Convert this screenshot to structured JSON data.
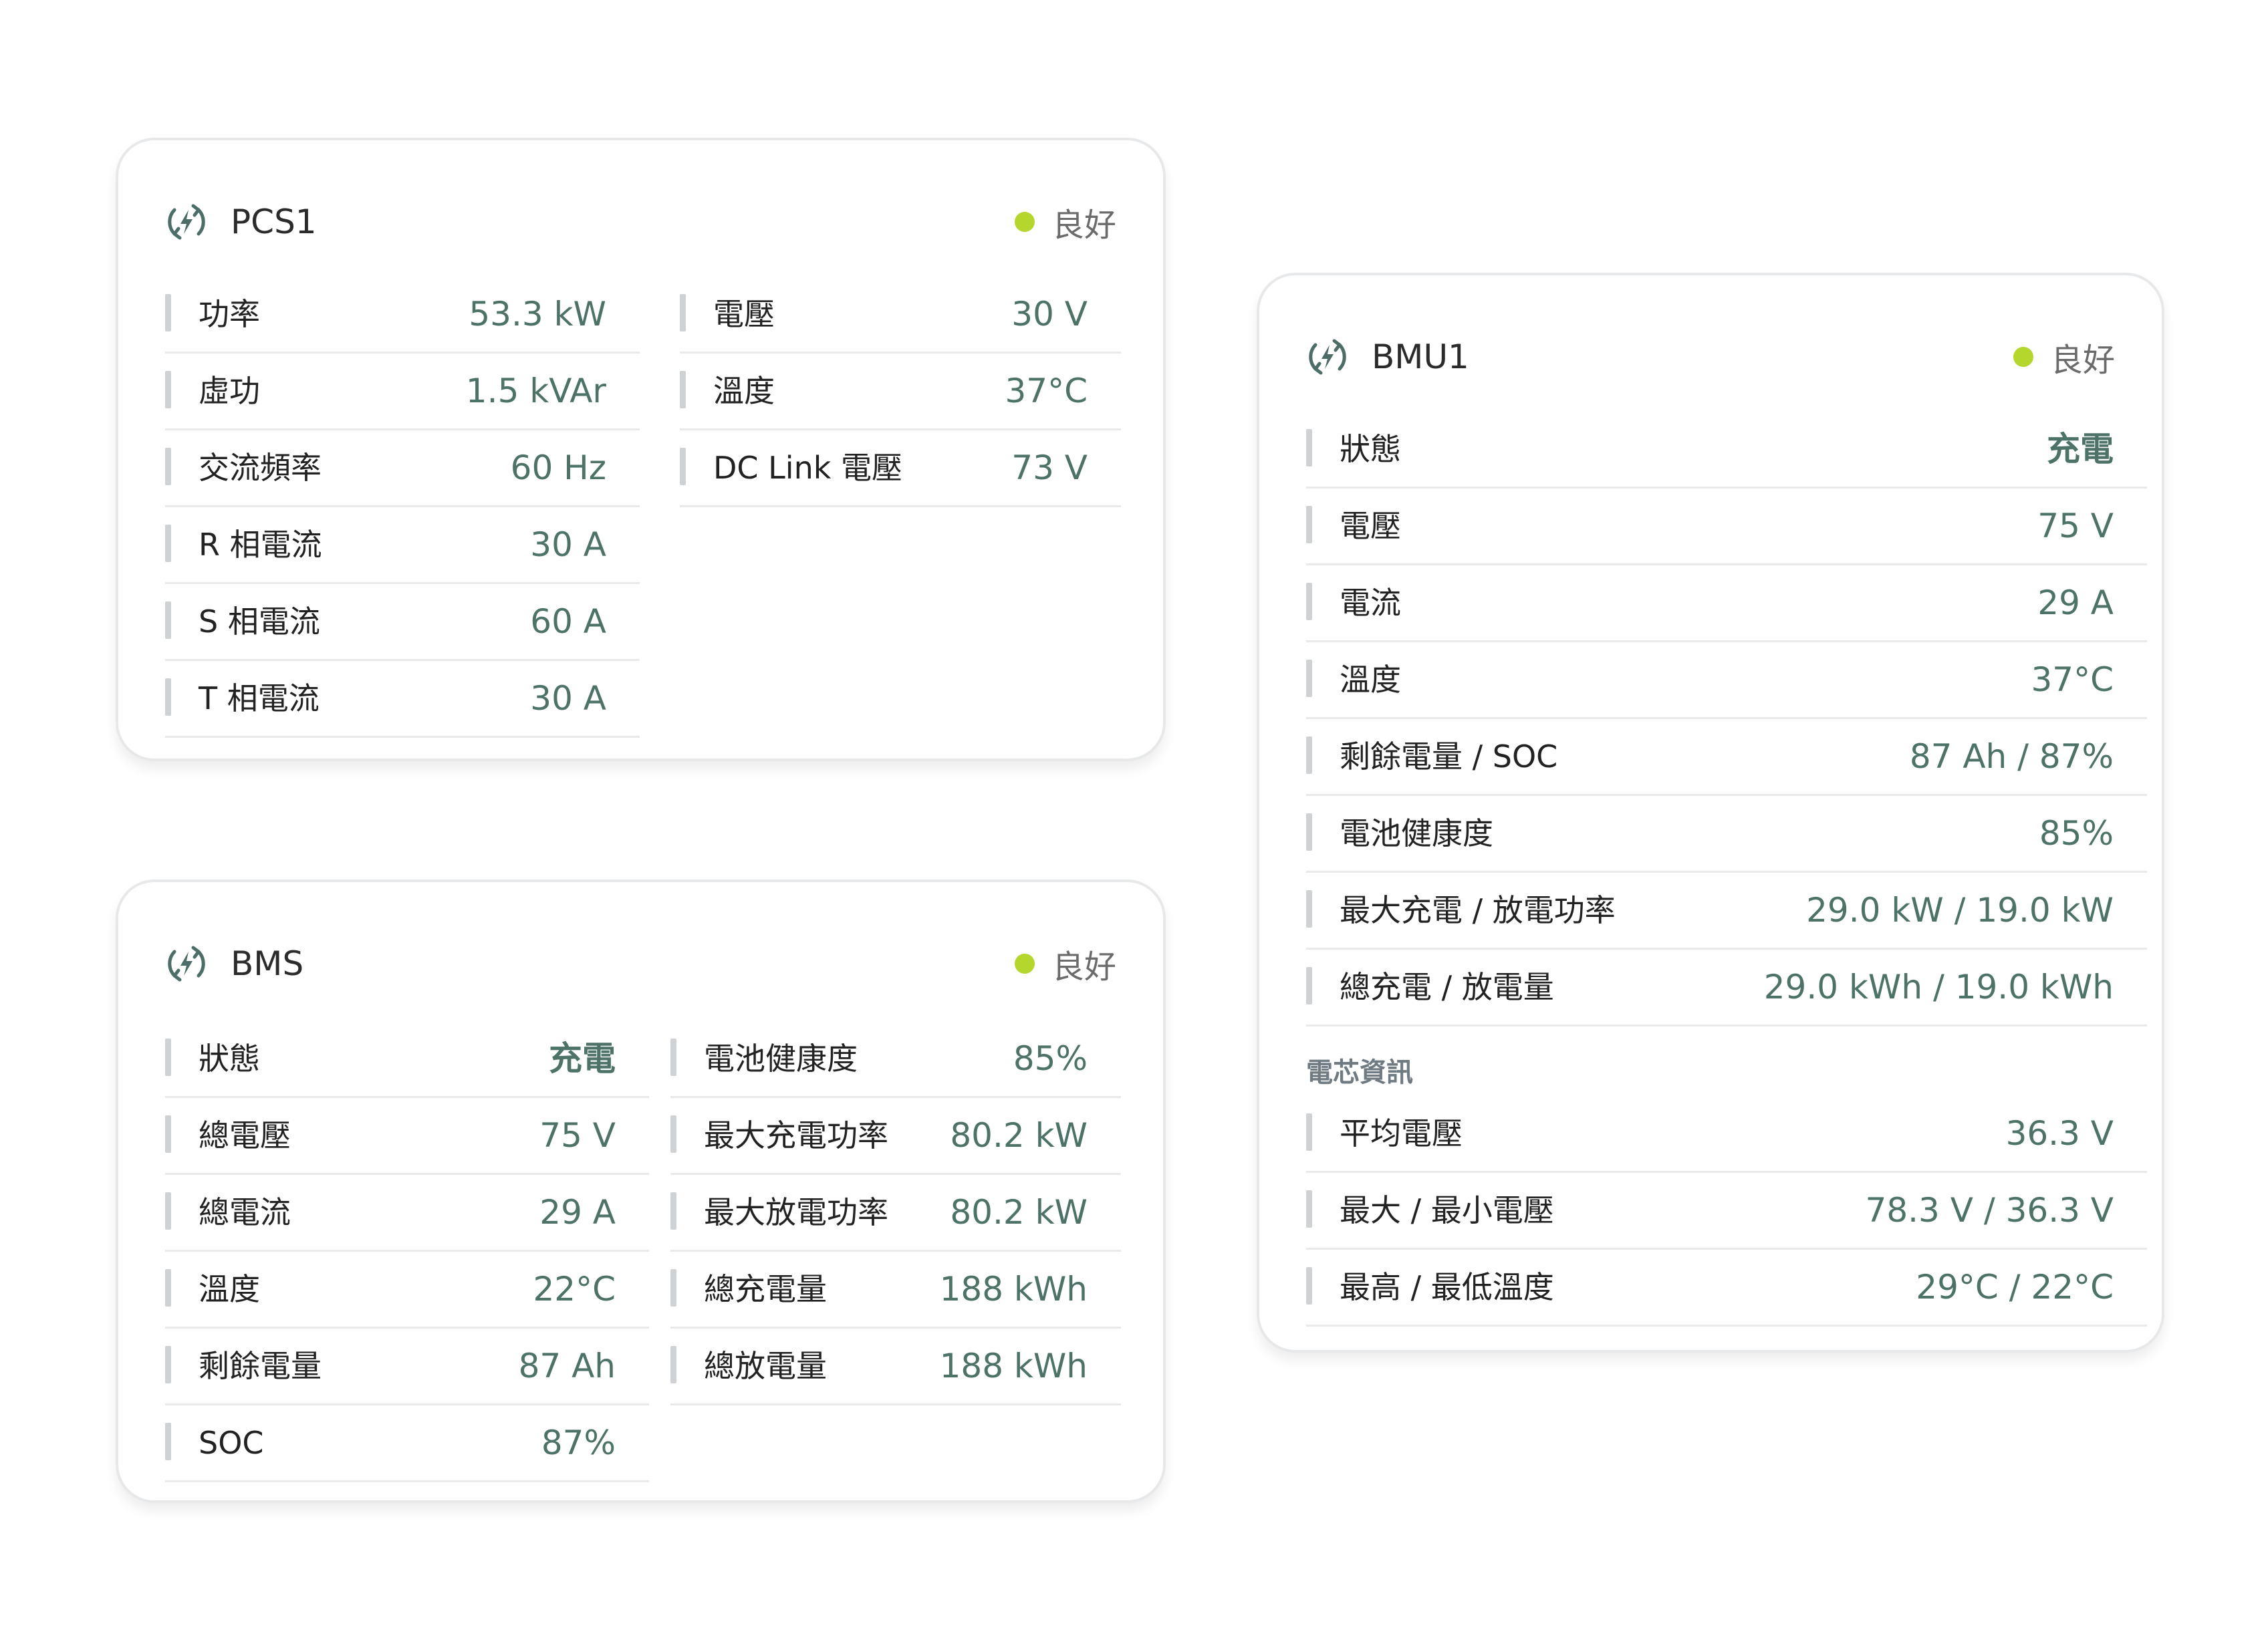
{
  "colors": {
    "status_good": "#b5d62c",
    "value_text": "#4d7268",
    "icon": "#4d6e68"
  },
  "pcs1": {
    "icon": "bolt-circle-icon",
    "title": "PCS1",
    "status": "良好",
    "left_rows": [
      {
        "label": "功率",
        "value": "53.3 kW"
      },
      {
        "label": "虛功",
        "value": "1.5 kVAr"
      },
      {
        "label": "交流頻率",
        "value": "60 Hz"
      },
      {
        "label": "R 相電流",
        "value": "30 A"
      },
      {
        "label": "S 相電流",
        "value": "60 A"
      },
      {
        "label": "T 相電流",
        "value": "30 A"
      }
    ],
    "right_rows": [
      {
        "label": "電壓",
        "value": "30 V"
      },
      {
        "label": "溫度",
        "value": "37°C"
      },
      {
        "label": "DC Link 電壓",
        "value": "73 V"
      }
    ]
  },
  "bms": {
    "icon": "bolt-circle-icon",
    "title": "BMS",
    "status": "良好",
    "left_rows": [
      {
        "label": "狀態",
        "value": "充電"
      },
      {
        "label": "總電壓",
        "value": "75 V"
      },
      {
        "label": "總電流",
        "value": "29 A"
      },
      {
        "label": "溫度",
        "value": "22°C"
      },
      {
        "label": "剩餘電量",
        "value": "87 Ah"
      },
      {
        "label": "SOC",
        "value": "87%"
      }
    ],
    "right_rows": [
      {
        "label": "電池健康度",
        "value": "85%"
      },
      {
        "label": "最大充電功率",
        "value": "80.2 kW"
      },
      {
        "label": "最大放電功率",
        "value": "80.2 kW"
      },
      {
        "label": "總充電量",
        "value": "188 kWh"
      },
      {
        "label": "總放電量",
        "value": "188 kWh"
      }
    ]
  },
  "bmu1": {
    "icon": "bolt-circle-icon",
    "title": "BMU1",
    "status": "良好",
    "rows": [
      {
        "label": "狀態",
        "value": "充電"
      },
      {
        "label": "電壓",
        "value": "75 V"
      },
      {
        "label": "電流",
        "value": "29 A"
      },
      {
        "label": "溫度",
        "value": "37°C"
      },
      {
        "label": "剩餘電量 / SOC",
        "value": "87 Ah / 87%"
      },
      {
        "label": "電池健康度",
        "value": "85%"
      },
      {
        "label": "最大充電 / 放電功率",
        "value": "29.0 kW / 19.0 kW"
      },
      {
        "label": "總充電 / 放電量",
        "value": "29.0 kWh / 19.0 kWh"
      }
    ],
    "cell_section_title": "電芯資訊",
    "cell_rows": [
      {
        "label": "平均電壓",
        "value": "36.3 V"
      },
      {
        "label": "最大 / 最小電壓",
        "value": "78.3 V / 36.3 V"
      },
      {
        "label": "最高 / 最低溫度",
        "value": "29°C / 22°C"
      }
    ]
  }
}
